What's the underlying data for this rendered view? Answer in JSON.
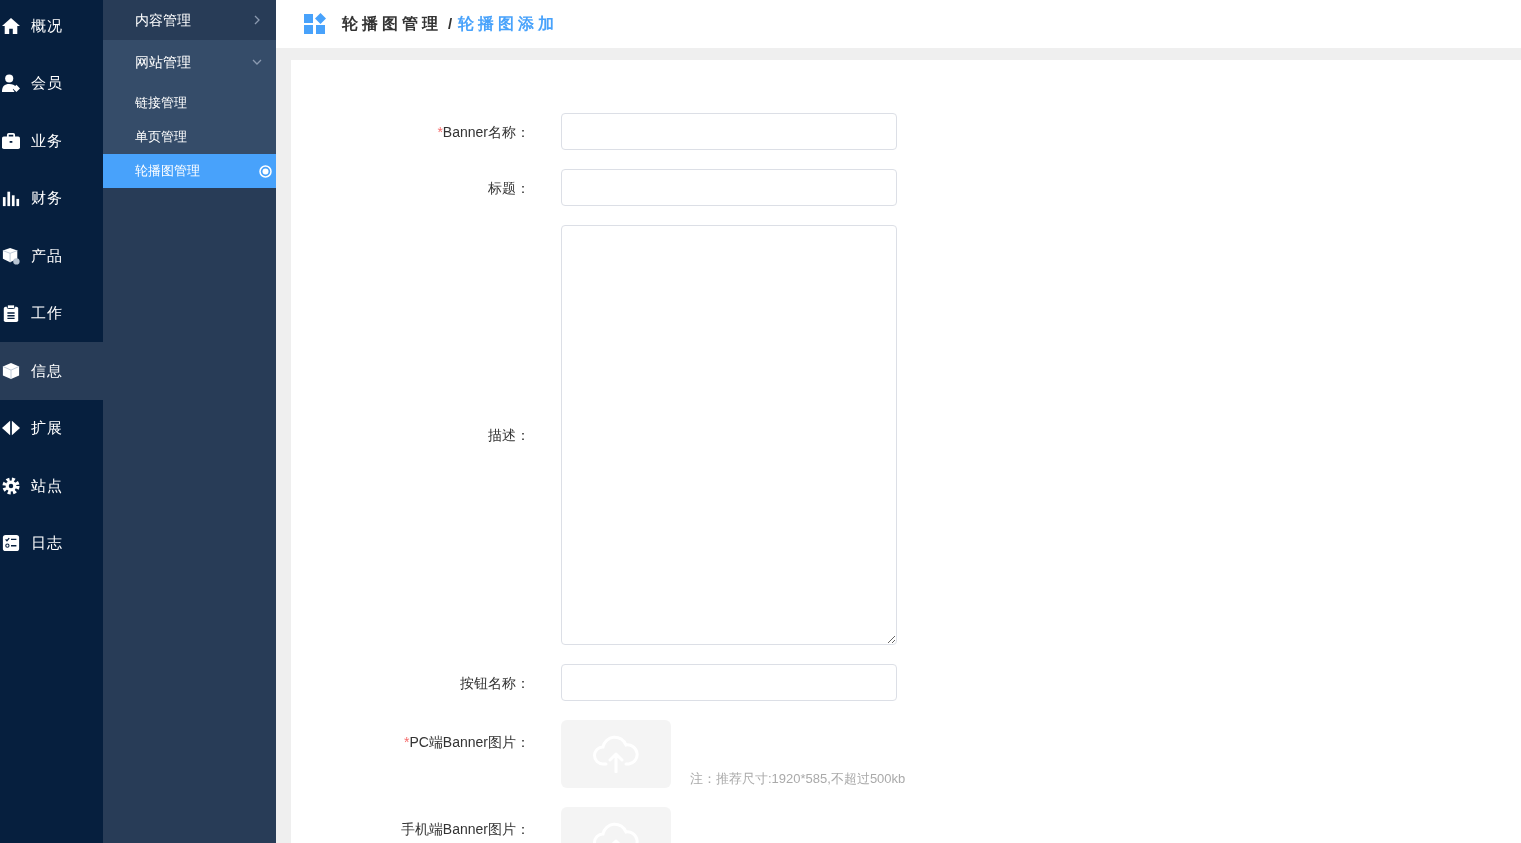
{
  "sidebar": {
    "items": [
      {
        "label": "概况",
        "selected": false
      },
      {
        "label": "会员",
        "selected": false
      },
      {
        "label": "业务",
        "selected": false
      },
      {
        "label": "财务",
        "selected": false
      },
      {
        "label": "产品",
        "selected": false
      },
      {
        "label": "工作",
        "selected": false
      },
      {
        "label": "信息",
        "selected": true
      },
      {
        "label": "扩展",
        "selected": false
      },
      {
        "label": "站点",
        "selected": false
      },
      {
        "label": "日志",
        "selected": false
      }
    ]
  },
  "submenu": [
    {
      "label": "内容管理",
      "expanded": false
    },
    {
      "label": "网站管理",
      "expanded": true,
      "children": [
        {
          "label": "链接管理",
          "selected": false
        },
        {
          "label": "单页管理",
          "selected": false
        },
        {
          "label": "轮播图管理",
          "selected": true
        }
      ]
    }
  ],
  "breadcrumb": {
    "items": [
      {
        "label": "轮播图管理",
        "current": false
      },
      {
        "label": "轮播图添加",
        "current": true
      }
    ],
    "separator": "/"
  },
  "form": {
    "fields": [
      {
        "kind": "input",
        "label": "Banner名称：",
        "required_mark": "*"
      },
      {
        "kind": "input",
        "label": "标题："
      },
      {
        "kind": "textarea",
        "label": "描述："
      },
      {
        "kind": "input",
        "label": "按钮名称："
      },
      {
        "kind": "upload",
        "label": "PC端Banner图片：",
        "required_mark": "*",
        "note": "注：推荐尺寸:1920*585,不超过500kb"
      },
      {
        "kind": "upload",
        "label": "手机端Banner图片："
      }
    ]
  }
}
